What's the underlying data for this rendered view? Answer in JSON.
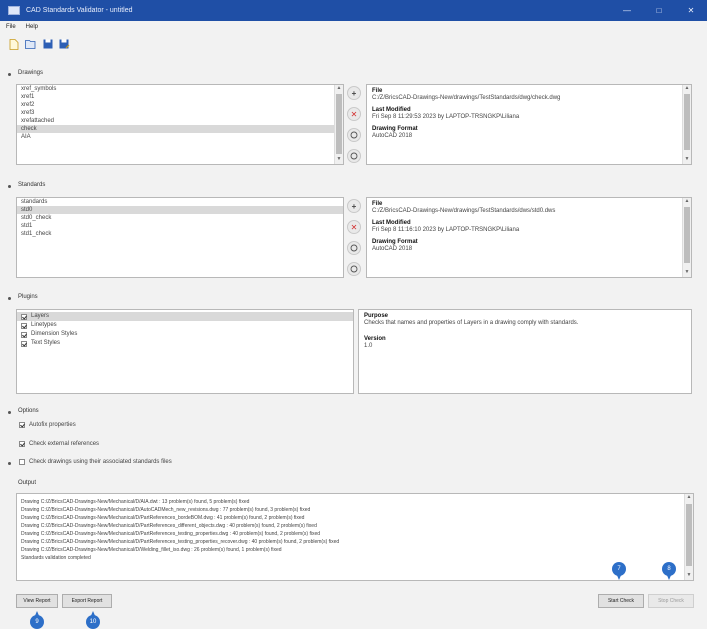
{
  "window": {
    "title": "CAD Standards Validator - untitled"
  },
  "menu": {
    "items": [
      "File",
      "Help"
    ]
  },
  "sections": {
    "drawings": "Drawings",
    "standards": "Standards",
    "plugins": "Plugins",
    "options": "Options",
    "output": "Output"
  },
  "drawings": {
    "items": [
      "xref_symbols",
      "xref1",
      "xref2",
      "xref3",
      "xrefattached",
      "check",
      "AIA"
    ],
    "selected_index": 5,
    "info": {
      "file_label": "File",
      "file_value": "C:/Z/BricsCAD-Drawings-New/drawings/TestStandards/dwg/check.dwg",
      "modified_label": "Last Modified",
      "modified_value": "Fri Sep 8 11:29:53 2023 by LAPTOP-TRSNGKP\\Liliana",
      "format_label": "Drawing Format",
      "format_value": "AutoCAD 2018"
    }
  },
  "standards": {
    "items": [
      "standards",
      "std0",
      "std0_check",
      "std1",
      "std1_check"
    ],
    "selected_index": 1,
    "info": {
      "file_label": "File",
      "file_value": "C:/Z/BricsCAD-Drawings-New/drawings/TestStandards/dws/std0.dws",
      "modified_label": "Last Modified",
      "modified_value": "Fri Sep 8 11:16:10 2023 by LAPTOP-TRSNGKP\\Liliana",
      "format_label": "Drawing Format",
      "format_value": "AutoCAD 2018"
    }
  },
  "plugins": {
    "items": [
      {
        "label": "Layers",
        "checked": true
      },
      {
        "label": "Linetypes",
        "checked": true
      },
      {
        "label": "Dimension Styles",
        "checked": true
      },
      {
        "label": "Text Styles",
        "checked": true
      }
    ],
    "selected_index": 0,
    "purpose_label": "Purpose",
    "purpose_value": "Checks that names and properties of Layers in a drawing comply with standards.",
    "version_label": "Version",
    "version_value": "1.0"
  },
  "options": {
    "autofix": {
      "label": "Autofix properties",
      "checked": true
    },
    "xrefs": {
      "label": "Check external references",
      "checked": true
    },
    "associated": {
      "label": "Check drawings using their associated standards files",
      "checked": false
    }
  },
  "output": {
    "lines": [
      "Drawing C:/Z/BricsCAD-Drawings-New/Mechanical/D/AIA.dwt : 13 problem(s) found, 5 problem(s) fixed",
      "Drawing C:/Z/BricsCAD-Drawings-New/Mechanical/D/AutoCADMech_new_revisions.dwg : 77 problem(s) found, 3 problem(s) fixed",
      "Drawing C:/Z/BricsCAD-Drawings-New/Mechanical/D/PartReferences_bordeBOM.dwg : 41 problem(s) found, 2 problem(s) fixed",
      "Drawing C:/Z/BricsCAD-Drawings-New/Mechanical/D/PartReferences_different_objects.dwg : 40 problem(s) found, 2 problem(s) fixed",
      "Drawing C:/Z/BricsCAD-Drawings-New/Mechanical/D/PartReferences_testing_properties.dwg : 40 problem(s) found, 2 problem(s) fixed",
      "Drawing C:/Z/BricsCAD-Drawings-New/Mechanical/D/PartReferences_testing_properties_recover.dwg : 40 problem(s) found, 2 problem(s) fixed",
      "Drawing C:/Z/BricsCAD-Drawings-New/Mechanical/D/Welding_fillet_iso.dwg : 26 problem(s) found, 1 problem(s) fixed",
      "Standards validation completed"
    ]
  },
  "buttons": {
    "view_report": "View Report",
    "export_report": "Export Report",
    "start_check": "Start Check",
    "stop_check": "Stop Check"
  },
  "callouts": {
    "start_check": "7",
    "stop_check": "8",
    "view_report": "9",
    "export_report": "10"
  },
  "colors": {
    "titlebar": "#1f4fa6",
    "callout": "#2d6fc8",
    "remove_icon": "#d32f2f"
  }
}
